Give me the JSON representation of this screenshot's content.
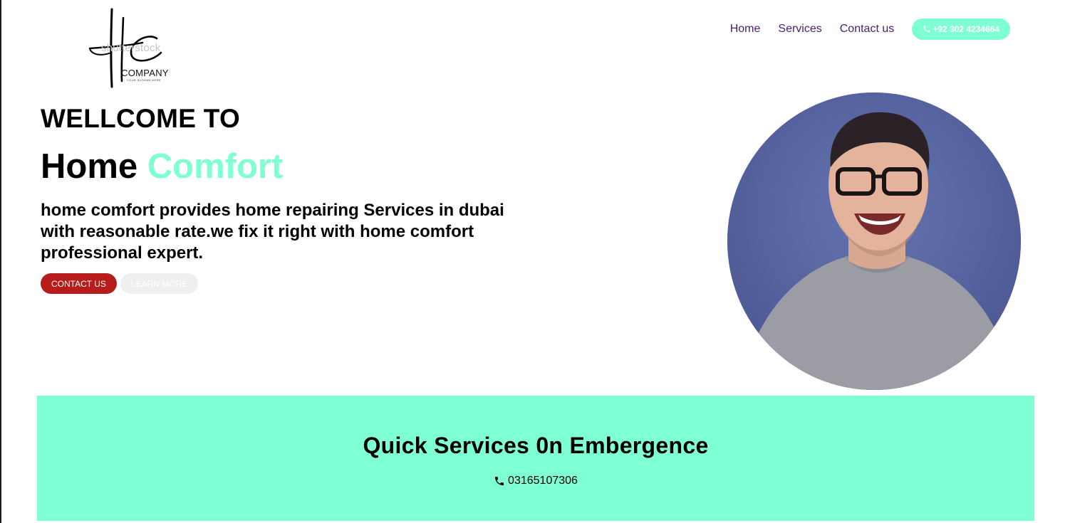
{
  "logo": {
    "watermark": "shutterstock",
    "company": "COMPANY",
    "slogan": "YOUR SLOGAN HERE",
    "icon": "hc-monogram"
  },
  "nav": {
    "items": [
      "Home",
      "Services",
      "Contact us"
    ],
    "phone": "+92 302 4234664",
    "phone_icon": "phone-icon"
  },
  "hero": {
    "pre_title": "WELLCOME TO",
    "title_main": "Home",
    "title_accent": "Comfort",
    "description": "home comfort provides home repairing Services in dubai with reasonable rate.we fix it right with home comfort professional expert.",
    "contact_button": "CONTACT US",
    "learn_button": "LEARN MORE"
  },
  "services": {
    "title": "Quick Services 0n Embergence",
    "phone": "03165107306",
    "phone_icon": "phone-icon"
  },
  "colors": {
    "accent": "#7fffd4",
    "nav_link": "#4a2070",
    "contact_button": "#b71c1c",
    "learn_button": "#efefef"
  }
}
